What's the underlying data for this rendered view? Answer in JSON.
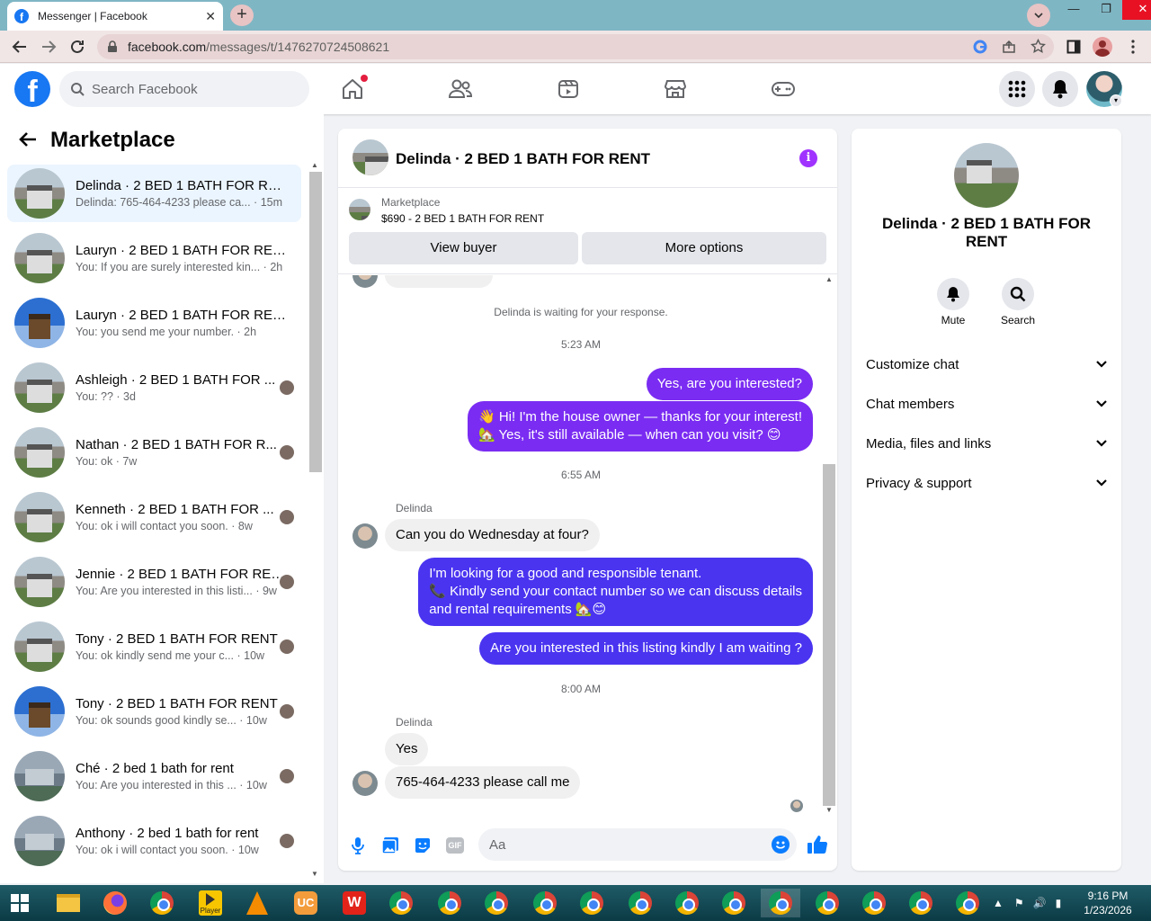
{
  "browser": {
    "tab_title": "Messenger | Facebook",
    "url_host": "facebook.com",
    "url_path": "/messages/t/1476270724508621"
  },
  "fb": {
    "search_placeholder": "Search Facebook"
  },
  "sidebar": {
    "title": "Marketplace",
    "conversations": [
      {
        "name": "Delinda · 2 BED 1 BATH FOR RENT",
        "preview": "Delinda: 765-464-4233 please ca... · 15m",
        "thumb": "house",
        "active": true
      },
      {
        "name": "Lauryn · 2 BED 1 BATH FOR RENT",
        "preview": "You: If you are surely interested kin... · 2h",
        "thumb": "house"
      },
      {
        "name": "Lauryn · 2 BED 1 BATH FOR RENT",
        "preview": "You: you send me your number. · 2h",
        "thumb": "blue-house"
      },
      {
        "name": "Ashleigh · 2 BED 1 BATH FOR ...",
        "preview": "You: ?? · 3d",
        "thumb": "house"
      },
      {
        "name": "Nathan · 2 BED 1 BATH FOR R...",
        "preview": "You: ok · 7w",
        "thumb": "house"
      },
      {
        "name": "Kenneth · 2 BED 1 BATH FOR ...",
        "preview": "You: ok i will contact you soon. · 8w",
        "thumb": "house"
      },
      {
        "name": "Jennie · 2 BED 1 BATH FOR RENT",
        "preview": "You: Are you interested in this listi... · 9w",
        "thumb": "house"
      },
      {
        "name": "Tony · 2 BED 1 BATH FOR RENT",
        "preview": "You: ok kindly send me your c... · 10w",
        "thumb": "house"
      },
      {
        "name": "Tony · 2 BED 1 BATH FOR RENT",
        "preview": "You: ok sounds good kindly se... · 10w",
        "thumb": "blue-house"
      },
      {
        "name": "Ché · 2 bed 1 bath for rent",
        "preview": "You: Are you interested in this ... · 10w",
        "thumb": "street"
      },
      {
        "name": "Anthony · 2 bed 1 bath for rent",
        "preview": "You: ok i will contact you soon. · 10w",
        "thumb": "street"
      }
    ]
  },
  "chat": {
    "title": "Delinda · 2 BED 1 BATH FOR RENT",
    "listing_category": "Marketplace",
    "listing_price": "$690 - 2 BED 1 BATH FOR RENT",
    "view_buyer": "View buyer",
    "more_options": "More options",
    "waiting": "Delinda is waiting for your response.",
    "time1": "5:23 AM",
    "msg_out1": "Yes, are you interested?",
    "msg_out2_l1": "👋 Hi! I'm the house owner — thanks for your interest!",
    "msg_out2_l2": "🏡 Yes, it's still available — when can you visit? 😊",
    "time2": "6:55 AM",
    "sender": "Delinda",
    "msg_in1": "Can you do Wednesday at four?",
    "msg_out3_l1": "I'm looking for a good and responsible tenant.",
    "msg_out3_l2": "📞 Kindly send your contact number so we can discuss details",
    "msg_out3_l3": "and rental requirements 🏡😊",
    "msg_out4": "Are you interested in this listing kindly I am waiting ?",
    "time3": "8:00 AM",
    "msg_in2": "Yes",
    "msg_in3": "765-464-4233 please call me",
    "input_placeholder": "Aa"
  },
  "right_panel": {
    "name": "Delinda · 2 BED 1 BATH FOR RENT",
    "mute": "Mute",
    "search": "Search",
    "sections": [
      "Customize chat",
      "Chat members",
      "Media, files and links",
      "Privacy & support"
    ]
  },
  "taskbar": {
    "time": "9:16 PM",
    "date": "1/23/2026",
    "player_label": "Player"
  }
}
